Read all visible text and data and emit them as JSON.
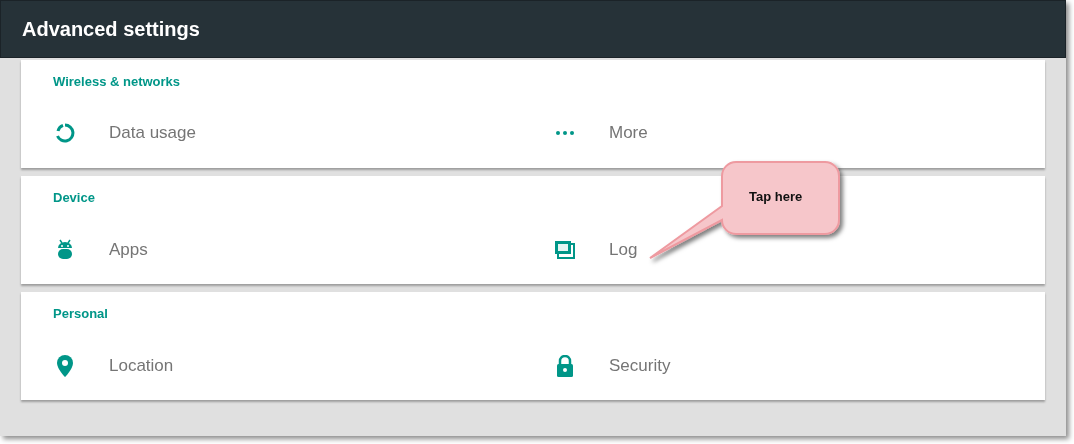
{
  "header": {
    "title": "Advanced settings"
  },
  "sections": [
    {
      "title": "Wireless & networks",
      "items": [
        {
          "label": "Data usage"
        },
        {
          "label": "More"
        }
      ]
    },
    {
      "title": "Device",
      "items": [
        {
          "label": "Apps"
        },
        {
          "label": "Log"
        }
      ]
    },
    {
      "title": "Personal",
      "items": [
        {
          "label": "Location"
        },
        {
          "label": "Security"
        }
      ]
    }
  ],
  "callout": {
    "text": "Tap here"
  }
}
